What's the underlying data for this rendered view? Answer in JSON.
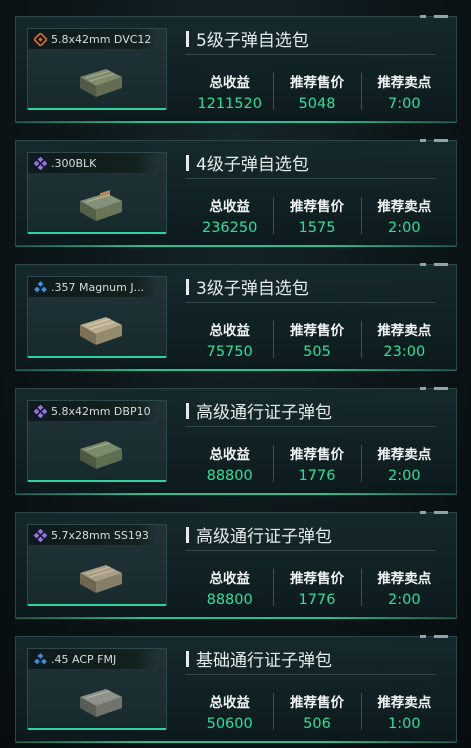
{
  "labels": {
    "total_income": "总收益",
    "recommended_price": "推荐售价",
    "recommended_sell": "推荐卖点"
  },
  "colors": {
    "value_green": "#31df9c",
    "accent_teal": "#2fd3a0",
    "rarity_orange": "#e0702a",
    "rarity_purple": "#9b6cf0",
    "rarity_blue": "#3f8fe0"
  },
  "cards": [
    {
      "item_name": "5.8x42mm DVC12",
      "rarity_icon": "orange-rarity-diamond-icon",
      "box_color": "green",
      "title": "5级子弹自选包",
      "total_income": "1211520",
      "recommended_price": "5048",
      "recommended_sell": "7:00"
    },
    {
      "item_name": ".300BLK",
      "rarity_icon": "purple-rarity-diamond-icon",
      "box_color": "green",
      "title": "4级子弹自选包",
      "total_income": "236250",
      "recommended_price": "1575",
      "recommended_sell": "2:00"
    },
    {
      "item_name": ".357 Magnum J...",
      "rarity_icon": "blue-rarity-diamond-icon",
      "box_color": "tan",
      "title": "3级子弹自选包",
      "total_income": "75750",
      "recommended_price": "505",
      "recommended_sell": "23:00"
    },
    {
      "item_name": "5.8x42mm DBP10",
      "rarity_icon": "purple-rarity-diamond-icon",
      "box_color": "green",
      "title": "高级通行证子弹包",
      "total_income": "88800",
      "recommended_price": "1776",
      "recommended_sell": "2:00"
    },
    {
      "item_name": "5.7x28mm SS193",
      "rarity_icon": "purple-rarity-diamond-icon",
      "box_color": "tan",
      "title": "高级通行证子弹包",
      "total_income": "88800",
      "recommended_price": "1776",
      "recommended_sell": "2:00"
    },
    {
      "item_name": ".45 ACP FMJ",
      "rarity_icon": "blue-rarity-diamond-icon",
      "box_color": "gray",
      "title": "基础通行证子弹包",
      "total_income": "50600",
      "recommended_price": "506",
      "recommended_sell": "1:00"
    }
  ]
}
